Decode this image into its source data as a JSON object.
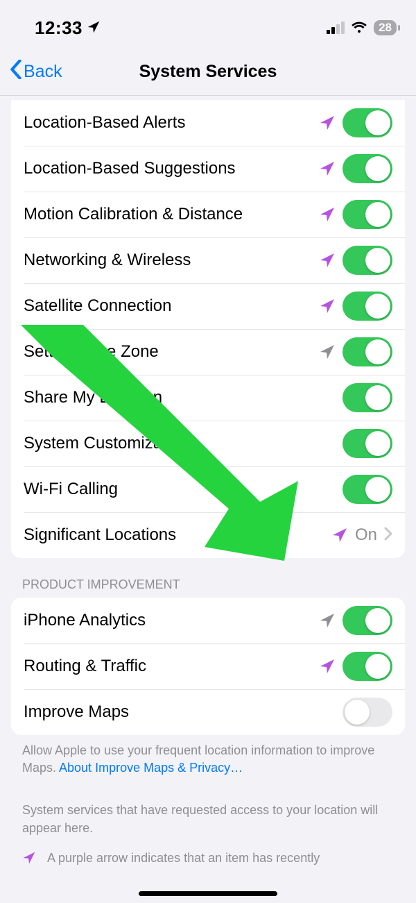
{
  "status": {
    "time": "12:33",
    "battery": "28"
  },
  "nav": {
    "back": "Back",
    "title": "System Services",
    "backColor": "#007aff"
  },
  "colors": {
    "arrowPurple": "#b553e0",
    "arrowGray": "#8e8e93",
    "toggleOn": "#34c759",
    "link": "#007aff",
    "overlayGreen": "#24d33d"
  },
  "services": [
    {
      "label": "Location-Based Alerts",
      "arrow": "purple",
      "toggle": "on"
    },
    {
      "label": "Location-Based Suggestions",
      "arrow": "purple",
      "toggle": "on"
    },
    {
      "label": "Motion Calibration & Distance",
      "arrow": "purple",
      "toggle": "on"
    },
    {
      "label": "Networking & Wireless",
      "arrow": "purple",
      "toggle": "on"
    },
    {
      "label": "Satellite Connection",
      "arrow": "purple",
      "toggle": "on"
    },
    {
      "label": "Setting Time Zone",
      "arrow": "gray",
      "toggle": "on"
    },
    {
      "label": "Share My Location",
      "arrow": "none",
      "toggle": "on"
    },
    {
      "label": "System Customization",
      "arrow": "none",
      "toggle": "on"
    },
    {
      "label": "Wi-Fi Calling",
      "arrow": "none",
      "toggle": "on"
    },
    {
      "label": "Significant Locations",
      "arrow": "purple",
      "link": true,
      "value": "On"
    }
  ],
  "productImprovementHeader": "PRODUCT IMPROVEMENT",
  "productImprovement": [
    {
      "label": "iPhone Analytics",
      "arrow": "gray",
      "toggle": "on"
    },
    {
      "label": "Routing & Traffic",
      "arrow": "purple",
      "toggle": "on"
    },
    {
      "label": "Improve Maps",
      "arrow": "none",
      "toggle": "off"
    }
  ],
  "footer1a": "Allow Apple to use your frequent location information to improve Maps. ",
  "footer1link": "About Improve Maps & Privacy…",
  "footer2": "System services that have requested access to your location will appear here.",
  "footer3": "A purple arrow indicates that an item has recently"
}
